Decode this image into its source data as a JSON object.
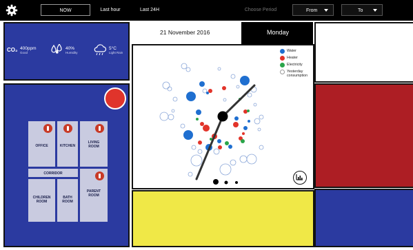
{
  "topbar": {
    "settings_icon": "gear-icon",
    "now_label": "NOW",
    "last_hour_label": "Last hour",
    "last_24h_label": "Last 24H",
    "choose_period_label": "Choose Period",
    "from_label": "From",
    "to_label": "To"
  },
  "weather": {
    "co2_symbol": "CO₂",
    "co2_value": "400ppm",
    "co2_status": "Good",
    "humidity_value": "40%",
    "humidity_label": "Humidity",
    "temperature_value": "5°C",
    "temperature_status": "Light Rain"
  },
  "floorplan": {
    "rooms": [
      {
        "label": "OFFICE"
      },
      {
        "label": "KITCHEN"
      },
      {
        "label": "LIVING ROOM"
      },
      {
        "label": "CORRIDOR"
      },
      {
        "label": "CHILDREN ROOM"
      },
      {
        "label": "BATH ROOM"
      },
      {
        "label": "PARENT ROOM"
      }
    ]
  },
  "clock": {
    "date": "21 November 2016",
    "weekday": "Monday"
  },
  "legend": [
    {
      "label": "Water",
      "color": "#1f6fd0"
    },
    {
      "label": "Heater",
      "color": "#e2342a"
    },
    {
      "label": "Electricity",
      "color": "#2aa54a"
    },
    {
      "label": "Yesterday consumption",
      "color": "#ffffff"
    }
  ],
  "colors": {
    "blue_panel": "#2b3aa0",
    "red_panel": "#ad1e24",
    "yellow_panel": "#f0e847",
    "alert_dot": "#e0342b"
  }
}
